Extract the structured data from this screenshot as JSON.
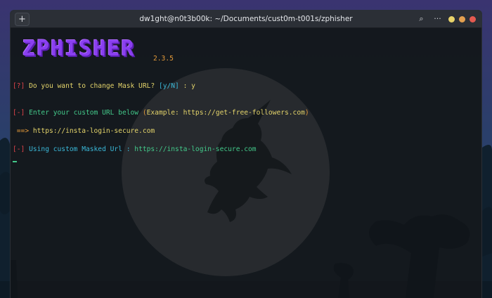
{
  "window": {
    "title": "dw1ght@n0t3b00k: ~/Documents/cust0m-t001s/zphisher",
    "new_tab_glyph": "+",
    "search_glyph": "⌕",
    "menu_glyph": "···",
    "buttons": [
      "#e8d36a",
      "#e3a050",
      "#e45a50"
    ]
  },
  "terminal": {
    "banner_text": "ZPHISHER",
    "version": "2.3.5",
    "line1": {
      "prefix": "[?]",
      "question": " Do you want to change Mask URL? ",
      "options": "[y/N]",
      "colon": " : ",
      "answer": "y"
    },
    "line2": {
      "prefix": "[-]",
      "text": " Enter your custom URL below ",
      "example_open": "(",
      "example_label": "Example: https://get-free-followers.com",
      "example_close": ")"
    },
    "line3": {
      "arrow": " ==>",
      "url": " https://insta-login-secure.com"
    },
    "line4": {
      "prefix": "[-]",
      "label": " Using custom Masked Url :",
      "url": " https://insta-login-secure.com"
    }
  },
  "colors": {
    "accent_purple": "#8a3ff0",
    "red": "#e0434a",
    "green": "#43c98a",
    "cyan": "#3ab8d8",
    "orange": "#e59a3a"
  }
}
